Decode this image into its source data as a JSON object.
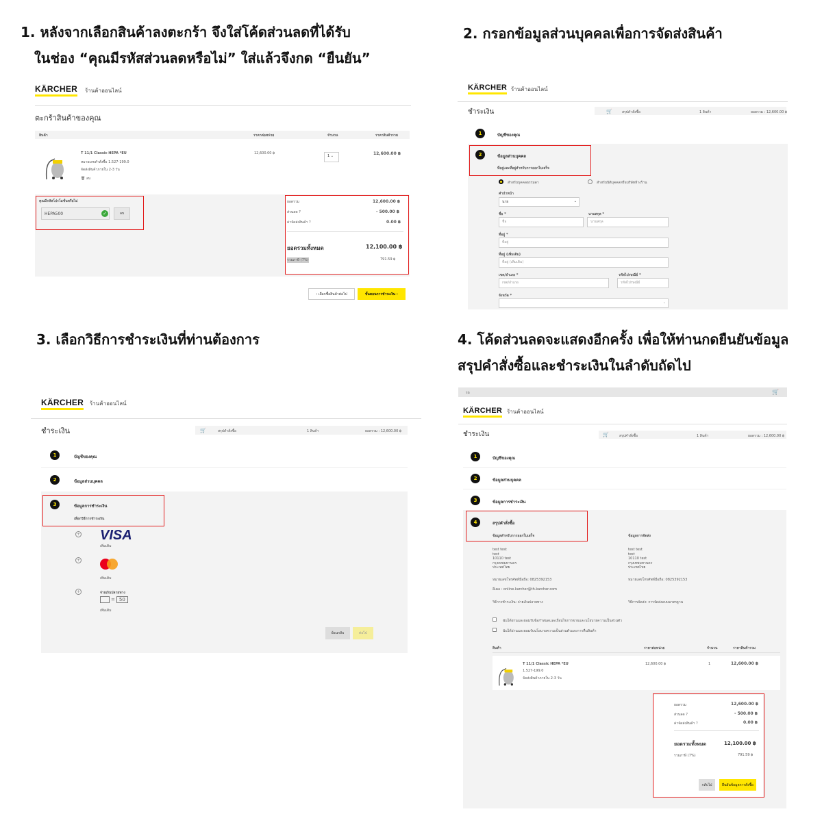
{
  "headings": {
    "step1_line1": "1. หลังจากเลือกสินค้าลงตะกร้า จึงใส่โค้ดส่วนลดที่ได้รับ",
    "step1_line2": "ในช่อง “คุณมีรหัสส่วนลดหรือไม่” ใส่แล้วจึงกด “ยืนยัน”",
    "step2": "2. กรอกข้อมูลส่วนบุคคลเพื่อการจัดส่งสินค้า",
    "step3": "3. เลือกวิธีการชำระเงินที่ท่านต้องการ",
    "step4_line1": "4. โค้ดส่วนลดจะแสดงอีกครั้ง เพื่อให้ท่านกดยืนยันข้อมูล",
    "step4_line2": "สรุปคำสั่งซื้อและชำระเงินในลำดับถัดไป"
  },
  "brand": {
    "logo": "KÄRCHER",
    "shop": "ร้านค้าออนไลน์",
    "accent": "#ffe600",
    "highlight": "#e21b1b"
  },
  "cart": {
    "title": "ตะกร้าสินค้าของคุณ",
    "columns": [
      "สินค้า",
      "ราคาต่อหน่วย",
      "จำนวน",
      "ราคาสินค้ารวม"
    ],
    "item": {
      "name": "T 11/1 Classic HEPA *EU",
      "code": "หมายเลขคำสั่งซื้อ 1.527-199.0",
      "ship": "จัดส่งสินค้าภายใน 2-3 วัน",
      "delete": "ลบ",
      "unit_price": "12,600.00 ฿",
      "qty": "1",
      "total": "12,600.00 ฿"
    },
    "coupon_label": "คุณมีรหัสโปรโมชั่นหรือไม่",
    "coupon_value": "HEPA500",
    "coupon_remove": "ลบ",
    "summary": {
      "subtotal_label": "ยอดรวม",
      "subtotal": "12,600.00 ฿",
      "discount_label": "ส่วนลด",
      "discount": "- 500.00 ฿",
      "shipping_label": "ค่าจัดส่งสินค้า",
      "shipping": "0.00 ฿",
      "grand_label": "ยอดรวมทั้งหมด",
      "grand": "12,100.00 ฿",
      "vat_label": "รวมภาษี (7%)",
      "vat": "791.59 ฿"
    },
    "back_button": "‹ เลือกซื้อสินค้าต่อไป",
    "checkout_button": "ขั้นตอนการชำระเงิน ›"
  },
  "checkout": {
    "title": "ชำระเงิน",
    "summary_label": "สรุปคำสั่งซื้อ",
    "items_count": "1 สินค้า",
    "total_text": "ยอดรวม : 12,600.00 ฿",
    "steps": [
      "บัญชีของคุณ",
      "ข้อมูลส่วนบุคคล",
      "ข้อมูลการชำระเงิน",
      "สรุปคำสั่งซื้อ"
    ],
    "step2_sub": "ที่อยู่และที่อยู่สำหรับการออกใบเสร็จ",
    "customer_private": "สำหรับบุคคลธรรมดา",
    "customer_business": "สำหรับนิติบุคคลหรือบริษัทห้างร้าน",
    "form": {
      "title_label": "คำนำหน้า",
      "title_value": "นาย",
      "first_label": "ชื่อ *",
      "first_ph": "ชื่อ",
      "last_label": "นามสกุล *",
      "last_ph": "นามสกุล",
      "addr_label": "ที่อยู่ *",
      "addr_ph": "ที่อยู่",
      "addr2_label": "ที่อยู่ (เพิ่มเติม)",
      "addr2_ph": "ที่อยู่ (เพิ่มเติม)",
      "district_label": "เขต/อำเภอ *",
      "district_ph": "เขต/อำเภอ",
      "zip_label": "รหัสไปรษณีย์ *",
      "zip_ph": "รหัสไปรษณีย์",
      "province_label": "จังหวัด *"
    },
    "payment_sub": "เลือกวิธีการชำระเงิน",
    "visa": "VISA",
    "more": "เพิ่มเติม",
    "cod": "จ่ายเงินปลายทาง",
    "cod_amount": "50",
    "back": "ย้อนกลับ",
    "next": "ต่อไป"
  },
  "summary_page": {
    "topbar_text": "รถ",
    "billing_head": "ข้อมูลสำหรับการออกใบเสร็จ",
    "shipping_head": "ข้อมูลการจัดส่ง",
    "address_lines": [
      "test test",
      "test",
      "10110 test",
      "กรุงเทพมหานคร",
      "ประเทศไทย"
    ],
    "phone": "หมายเลขโทรศัพท์มือถือ: 0825392153",
    "email": "อีเมล : online.karcher@th.karcher.com",
    "pay_method": "วิธีการชำระเงิน: จ่ายเงินปลายทาง",
    "ship_method": "วิธีการจัดส่ง: การจัดส่งแบบมาตรฐาน",
    "terms1": "ฉันได้อ่านและยอมรับข้อกำหนดและเงื่อนไขการขายและนโยบายความเป็นส่วนตัว",
    "terms2": "ฉันได้อ่านและยอมรับนโยบายความเป็นส่วนตัวและการคืนสินค้า",
    "item_code": "1.527-199.0",
    "item_ship": "จัดส่งสินค้าภายใน 2-3 วัน",
    "back": "กลับไป",
    "confirm": "ยืนยันข้อมูลการสั่งซื้อ"
  }
}
